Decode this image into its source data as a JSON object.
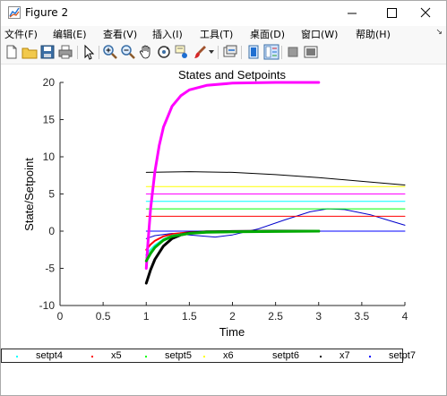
{
  "window": {
    "title": "Figure 2",
    "menus": [
      "文件(F)",
      "编辑(E)",
      "查看(V)",
      "插入(I)",
      "工具(T)",
      "桌面(D)",
      "窗口(W)",
      "帮助(H)"
    ]
  },
  "toolbar": {
    "icons": [
      "new-file-icon",
      "open-folder-icon",
      "save-icon",
      "print-icon",
      "pointer-icon",
      "zoom-in-icon",
      "zoom-out-icon",
      "pan-icon",
      "rotate-3d-icon",
      "data-cursor-icon",
      "brush-icon",
      "link-plot-icon",
      "hide-plot-tools-icon",
      "show-plot-tools-icon",
      "plot-tools-dock-icon"
    ]
  },
  "chart_data": {
    "type": "line",
    "title": "States and Setpoints",
    "xlabel": "Time",
    "ylabel": "State/Setpoint",
    "xlim": [
      0,
      4
    ],
    "ylim": [
      -10,
      20
    ],
    "xticks": [
      "0",
      "0.5",
      "1",
      "1.5",
      "2",
      "2.5",
      "3",
      "3.5",
      "4"
    ],
    "yticks": [
      "-10",
      "-5",
      "0",
      "5",
      "10",
      "15",
      "20"
    ],
    "grid": false,
    "legend": {
      "placement": "bottom",
      "entries": [
        {
          "label": "setpt4",
          "color": "#00ffff"
        },
        {
          "label": "x5",
          "color": "#ff0000"
        },
        {
          "label": "setpt5",
          "color": "#00ff00"
        },
        {
          "label": "x6",
          "color": "#ffff00"
        },
        {
          "label": "setpt6",
          "color": "#ffffff"
        },
        {
          "label": "x7",
          "color": "#000000"
        },
        {
          "label": "setpt7",
          "color": "#0000ff"
        }
      ]
    },
    "series": [
      {
        "color": "#ff00ff",
        "width": 3,
        "x": [
          1,
          1.02,
          1.05,
          1.1,
          1.15,
          1.2,
          1.3,
          1.4,
          1.5,
          1.7,
          2,
          2.5,
          3
        ],
        "y": [
          -5,
          -1.5,
          3,
          8,
          11.5,
          14,
          16.8,
          18.2,
          19,
          19.6,
          19.9,
          20,
          20
        ]
      },
      {
        "color": "#000000",
        "width": 3,
        "x": [
          1,
          1.05,
          1.1,
          1.2,
          1.3,
          1.4,
          1.5,
          1.7,
          2,
          2.5,
          3
        ],
        "y": [
          -7,
          -5.2,
          -3.8,
          -2,
          -1,
          -0.5,
          -0.25,
          -0.1,
          -0.05,
          0,
          0
        ]
      },
      {
        "color": "#00aa00",
        "width": 3,
        "x": [
          1,
          1.05,
          1.1,
          1.2,
          1.3,
          1.5,
          1.7,
          2,
          2.5,
          3
        ],
        "y": [
          -4,
          -3,
          -2.2,
          -1.2,
          -0.7,
          -0.3,
          -0.15,
          -0.1,
          -0.05,
          0
        ]
      },
      {
        "color": "#ff0000",
        "width": 2,
        "x": [
          1,
          1.05,
          1.1,
          1.2,
          1.3,
          1.5,
          1.7,
          2,
          2.5,
          3
        ],
        "y": [
          -2.5,
          -1.8,
          -1.3,
          -0.7,
          -0.4,
          -0.15,
          -0.1,
          0,
          0,
          0
        ]
      },
      {
        "color": "#00ffff",
        "width": 2,
        "x": [
          1,
          1.05,
          1.1,
          1.2,
          1.3,
          1.5,
          1.7,
          2,
          2.5,
          3
        ],
        "y": [
          -3.2,
          -2.5,
          -1.9,
          -1.1,
          -0.6,
          -0.25,
          -0.1,
          0,
          0,
          0
        ]
      },
      {
        "color": "#7ff5a8",
        "width": 2,
        "x": [
          1,
          1.05,
          1.1,
          1.2,
          1.3,
          1.5,
          1.7,
          2,
          2.5,
          3
        ],
        "y": [
          -3.6,
          -2.7,
          -2.1,
          -1.3,
          -0.8,
          -0.3,
          -0.15,
          -0.05,
          0,
          0
        ]
      },
      {
        "color": "#0000cc",
        "width": 1,
        "x": [
          1,
          1.1,
          1.3,
          1.5,
          1.8,
          2,
          2.3,
          2.6,
          2.9,
          3.1,
          3.3,
          3.6,
          3.8,
          4
        ],
        "y": [
          -1,
          -0.6,
          -0.3,
          -0.5,
          -0.8,
          -0.5,
          0.3,
          1.5,
          2.6,
          3,
          2.9,
          2.2,
          1.5,
          0.8
        ]
      },
      {
        "color": "#000000",
        "width": 1,
        "x": [
          1,
          1.5,
          2,
          2.5,
          3,
          3.5,
          4
        ],
        "y": [
          7.9,
          8.0,
          7.9,
          7.6,
          7.2,
          6.7,
          6.2
        ]
      },
      {
        "color": "#ffff00",
        "width": 1,
        "x": [
          1,
          4
        ],
        "y": [
          6,
          6
        ]
      },
      {
        "color": "#ff00ff",
        "width": 1,
        "x": [
          1,
          4
        ],
        "y": [
          5,
          5
        ]
      },
      {
        "color": "#00ffff",
        "width": 1,
        "x": [
          1,
          4
        ],
        "y": [
          4,
          4
        ]
      },
      {
        "color": "#00ff00",
        "width": 1,
        "x": [
          1,
          4
        ],
        "y": [
          3,
          3
        ]
      },
      {
        "color": "#ff0000",
        "width": 1,
        "x": [
          1,
          4
        ],
        "y": [
          2,
          2
        ]
      },
      {
        "color": "#0000ff",
        "width": 1,
        "x": [
          1,
          4
        ],
        "y": [
          0,
          0
        ]
      }
    ]
  }
}
